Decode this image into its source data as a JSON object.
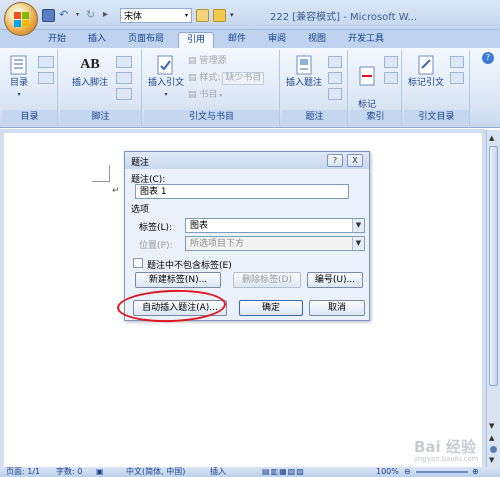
{
  "window": {
    "title": "222 [兼容模式] - Microsoft W...",
    "quick_access_font": "宋体"
  },
  "tabs": [
    "开始",
    "插入",
    "页面布局",
    "引用",
    "邮件",
    "审阅",
    "视图",
    "开发工具"
  ],
  "ribbon": {
    "groups": {
      "toc": {
        "label": "目录",
        "btn": "目录"
      },
      "footnote": {
        "label": "脚注",
        "btn_insert": "插入脚注",
        "ab_glyph": "AB"
      },
      "citation": {
        "label": "引文与书目",
        "btn_insert": "插入引文",
        "manage": "管理源",
        "style": "样式:",
        "style_value": "缺少书目",
        "bib": "书目"
      },
      "caption": {
        "label": "题注",
        "btn_insert": "插入题注"
      },
      "index": {
        "label": "索引",
        "btn_mark": "标记\n索引项"
      },
      "toa": {
        "label": "引文目录",
        "btn_mark": "标记引文"
      }
    }
  },
  "dialog": {
    "title": "题注",
    "help_btn": "?",
    "close_btn": "X",
    "caption_label": "题注(C):",
    "caption_value": "图表 1",
    "options_label": "选项",
    "label_label": "标签(L):",
    "label_value": "图表",
    "position_label": "位置(P):",
    "position_value": "所选项目下方",
    "exclude_label": "题注中不包含标签(E)",
    "btn_new_label": "新建标签(N)...",
    "btn_delete_label": "删除标签(D)",
    "btn_numbering": "编号(U)...",
    "btn_autocaption": "自动插入题注(A)...",
    "btn_ok": "确定",
    "btn_cancel": "取消"
  },
  "status": {
    "page": "页面: 1/1",
    "words": "字数: 0",
    "language": "中文(简体, 中国)",
    "mode": "插入",
    "zoom": "100%"
  },
  "watermark": {
    "brand": "Bai 经验",
    "url": "jingyan.baidu.com"
  },
  "colors": {
    "ribbon_text": "#15428b",
    "accent_red": "#e0141e"
  }
}
